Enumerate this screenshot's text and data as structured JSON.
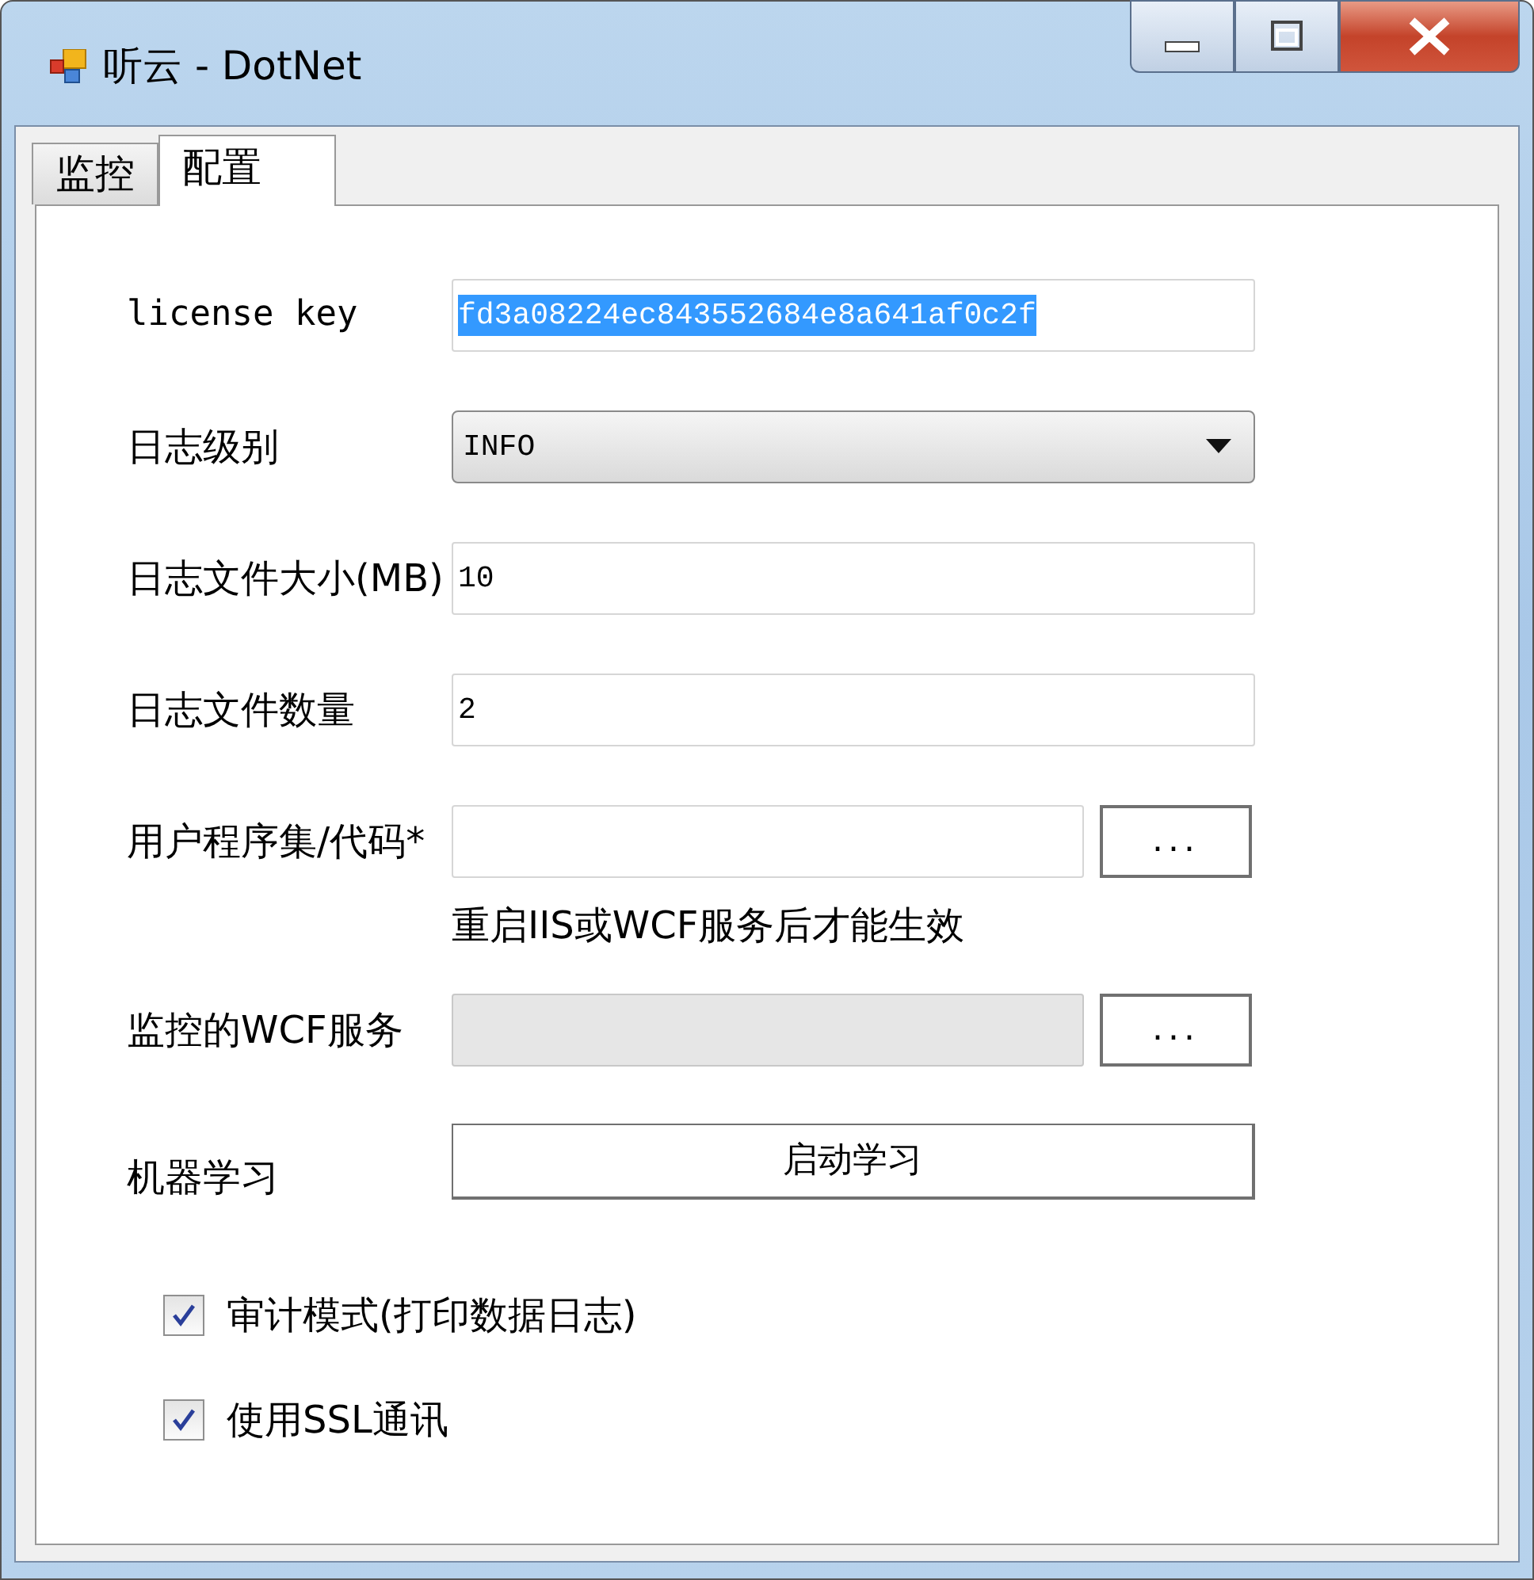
{
  "window": {
    "title": "听云 - DotNet"
  },
  "tabs": [
    {
      "label": "监控",
      "selected": false
    },
    {
      "label": "配置",
      "selected": true
    }
  ],
  "fields": [
    {
      "kind": "text",
      "label": "license key",
      "value": "fd3a08224ec843552684e8a641af0c2f",
      "highlighted": true
    },
    {
      "kind": "dropdown",
      "label": "日志级别",
      "value": "INFO"
    },
    {
      "kind": "text",
      "label": "日志文件大小(MB)",
      "value": "10",
      "highlighted": false
    },
    {
      "kind": "text",
      "label": "日志文件数量",
      "value": "2",
      "highlighted": false
    },
    {
      "kind": "browse",
      "label": "用户程序集/代码*",
      "button": "...",
      "disabled": false
    },
    {
      "kind": "note",
      "text": "重启IIS或WCF服务后才能生效"
    },
    {
      "kind": "browse",
      "label": "监控的WCF服务",
      "button": "...",
      "disabled": true
    },
    {
      "kind": "action",
      "label": "机器学习",
      "button": "启动学习"
    }
  ],
  "checkboxes": [
    {
      "label": "审计模式(打印数据日志)",
      "checked": true
    },
    {
      "label": "使用SSL通讯",
      "checked": true
    }
  ]
}
